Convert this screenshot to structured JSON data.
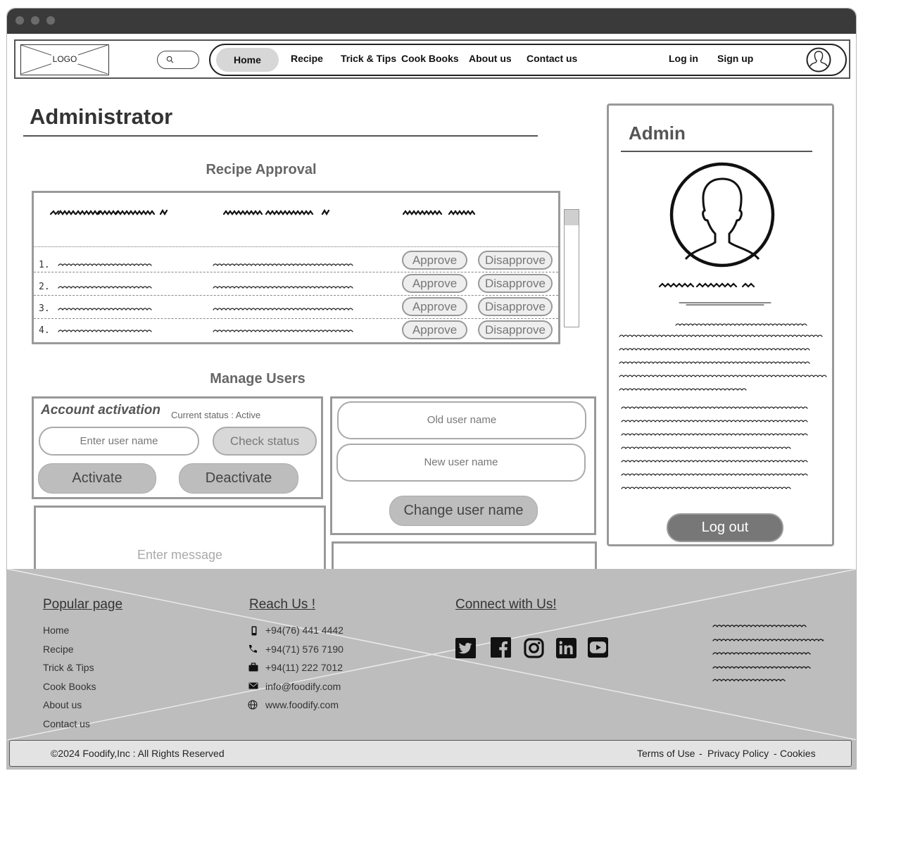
{
  "logo": {
    "text": "LOGO"
  },
  "nav": {
    "items": [
      "Home",
      "Recipe",
      "Trick & Tips",
      "Cook Books",
      "About us",
      "Contact us"
    ],
    "active": "Home",
    "login": "Log in",
    "signup": "Sign up"
  },
  "page": {
    "title": "Administrator"
  },
  "recipe_approval": {
    "title": "Recipe Approval",
    "rows": [
      {
        "num": "1.",
        "approve": "Approve",
        "disapprove": "Disapprove"
      },
      {
        "num": "2.",
        "approve": "Approve",
        "disapprove": "Disapprove"
      },
      {
        "num": "3.",
        "approve": "Approve",
        "disapprove": "Disapprove"
      },
      {
        "num": "4.",
        "approve": "Approve",
        "disapprove": "Disapprove"
      }
    ]
  },
  "manage_users": {
    "title": "Manage Users",
    "account_activation": {
      "title": "Account activation",
      "current_status": "Current status : Active",
      "username_placeholder": "Enter user name",
      "check_status": "Check status",
      "activate": "Activate",
      "deactivate": "Deactivate"
    },
    "message_placeholder": "Enter  message",
    "rename": {
      "old_placeholder": "Old user name",
      "new_placeholder": "New user name",
      "button": "Change user name"
    }
  },
  "admin_panel": {
    "title": "Admin",
    "logout": "Log out"
  },
  "footer": {
    "popular": {
      "title": "Popular page",
      "links": [
        "Home",
        "Recipe",
        "Trick & Tips",
        "Cook Books",
        "About us",
        "Contact us"
      ]
    },
    "reach": {
      "title": "Reach Us !",
      "items": [
        {
          "icon": "mobile-phone-icon",
          "text": "+94(76) 441 4442"
        },
        {
          "icon": "phone-icon",
          "text": "+94(71) 576 7190"
        },
        {
          "icon": "briefcase-icon",
          "text": "+94(11) 222 7012"
        },
        {
          "icon": "mail-icon",
          "text": "info@foodify.com"
        },
        {
          "icon": "globe-icon",
          "text": "www.foodify.com"
        }
      ]
    },
    "connect": {
      "title": "Connect with Us!",
      "icons": [
        "twitter-icon",
        "facebook-icon",
        "instagram-icon",
        "linkedin-icon",
        "youtube-icon"
      ]
    },
    "copyright": "©2024  Foodify,Inc : All Rights Reserved",
    "legal": {
      "terms": "Terms of Use",
      "privacy": "Privacy Policy",
      "cookies": "Cookies",
      "separator": "-"
    }
  },
  "colors": {
    "titlebar": "#3a3a3a",
    "footer_bg": "#bdbdbd",
    "button_gray": "#bdbdbd",
    "logout_bg": "#777777",
    "active_nav": "#d7d7d7"
  }
}
